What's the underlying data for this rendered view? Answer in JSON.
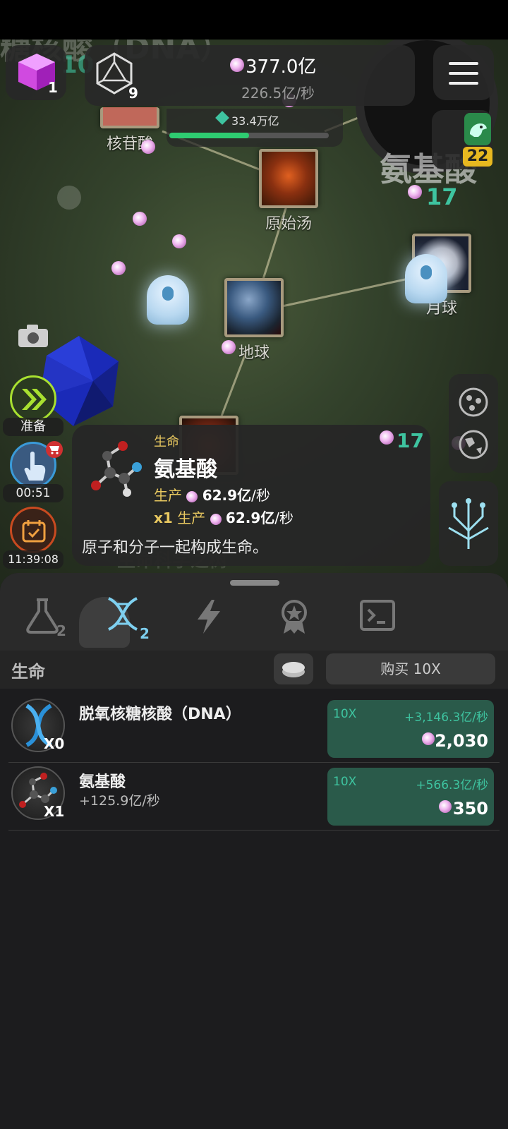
{
  "hud": {
    "cube_count": "1",
    "icosa_count": "9",
    "total_value": "377.0亿",
    "rate": "226.5亿/秒",
    "progress_value": "33.4万亿",
    "progress_fraction": 0.5,
    "dino_level": "22",
    "bg_left_partial": "糖核酸（DNA）",
    "bg_left_num": "10"
  },
  "map": {
    "bg_title": "氨基酸",
    "bg_count": "17",
    "nodes": {
      "nucleoside": "核苷酸",
      "primordial_soup": "原始汤",
      "earth": "地球",
      "moon": "月球"
    },
    "bg_bottom": "生命科学之树"
  },
  "left_controls": {
    "ready_label": "准备",
    "timer1": "00:51",
    "timer2": "11:39:08"
  },
  "tooltip": {
    "category": "生命",
    "title": "氨基酸",
    "count": "17",
    "produce_label": "生产",
    "produce_value": "62.9亿",
    "produce_unit": "/秒",
    "mult_label": "x1",
    "mult_produce_label": "生产",
    "mult_value": "62.9亿",
    "mult_unit": "/秒",
    "description": "原子和分子一起构成生命。"
  },
  "tabs": {
    "flask_badge": "2",
    "dna_badge": "2"
  },
  "list": {
    "section_title": "生命",
    "buy_button": "购买 10X",
    "items": [
      {
        "name": "脱氧核糖核酸（DNA）",
        "owned": "X0",
        "sub": "",
        "buy_mult": "10X",
        "buy_rate": "+3,146.3亿/秒",
        "cost": "2,030"
      },
      {
        "name": "氨基酸",
        "owned": "X1",
        "sub": "+125.9亿/秒",
        "buy_mult": "10X",
        "buy_rate": "+566.3亿/秒",
        "cost": "350"
      }
    ]
  },
  "colors": {
    "accent_teal": "#3ec4a0",
    "buy_green": "#2a5a4a",
    "progress_green": "#2ecc71",
    "gold": "#e8c860",
    "lime": "#a8e030"
  }
}
